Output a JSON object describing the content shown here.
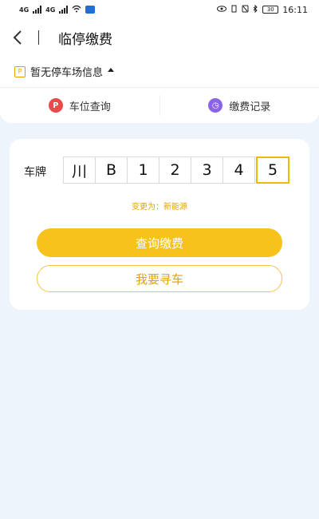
{
  "status_bar": {
    "network_tag_1": "4G",
    "network_tag_2": "4G",
    "battery": "30",
    "time": "16:11"
  },
  "header": {
    "title": "临停缴费"
  },
  "lot": {
    "text": "暂无停车场信息"
  },
  "tabs": [
    {
      "label": "车位查询",
      "icon": "parking-icon",
      "icon_glyph": "P"
    },
    {
      "label": "缴费记录",
      "icon": "clock-icon",
      "icon_glyph": "◷"
    }
  ],
  "plate": {
    "label": "车牌",
    "chars": [
      "川",
      "B",
      "1",
      "2",
      "3",
      "4",
      "5"
    ],
    "active_index": 6,
    "switch_hint": "变更为：新能源"
  },
  "buttons": {
    "primary": "查询缴费",
    "secondary": "我要寻车"
  },
  "colors": {
    "accent": "#f7c21b",
    "accent_text": "#e3a300",
    "background": "#eef4fb"
  }
}
